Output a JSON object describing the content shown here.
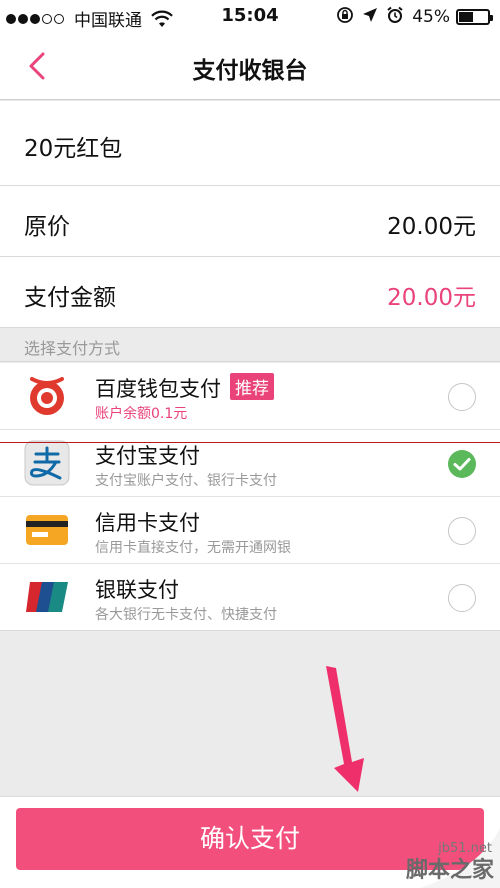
{
  "status_bar": {
    "carrier": "中国联通",
    "time": "15:04",
    "battery": "45%",
    "battery_level": 0.45
  },
  "nav": {
    "title": "支付收银台"
  },
  "order": {
    "item_name": "20元红包",
    "original_price_label": "原价",
    "original_price": "20.00元",
    "pay_amount_label": "支付金额",
    "pay_amount": "20.00元"
  },
  "payment": {
    "section_title": "选择支付方式",
    "methods": [
      {
        "name": "百度钱包支付",
        "badge": "推荐",
        "sub": "账户余额0.1元",
        "selected": false,
        "icon": "baidu-wallet-icon"
      },
      {
        "name": "支付宝支付",
        "sub": "支付宝账户支付、银行卡支付",
        "selected": true,
        "icon": "alipay-icon"
      },
      {
        "name": "信用卡支付",
        "sub": "信用卡直接支付，无需开通网银",
        "selected": false,
        "icon": "credit-card-icon"
      },
      {
        "name": "银联支付",
        "sub": "各大银行无卡支付、快捷支付",
        "selected": false,
        "icon": "unionpay-icon"
      }
    ]
  },
  "confirm_button": "确认支付",
  "watermark": {
    "site": "jb51.net",
    "name": "脚本之家"
  },
  "colors": {
    "accent": "#e9437a",
    "button": "#f34f7d",
    "check": "#5bb85b"
  }
}
